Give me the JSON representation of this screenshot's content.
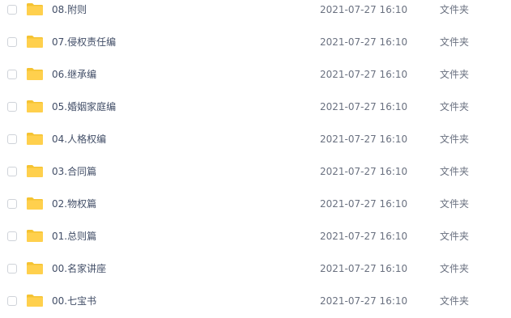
{
  "files": [
    {
      "name": "08.附则",
      "modified": "2021-07-27 16:10",
      "type": "文件夹",
      "icon": "folder-icon"
    },
    {
      "name": "07.侵权责任编",
      "modified": "2021-07-27 16:10",
      "type": "文件夹",
      "icon": "folder-icon"
    },
    {
      "name": "06.继承编",
      "modified": "2021-07-27 16:10",
      "type": "文件夹",
      "icon": "folder-icon"
    },
    {
      "name": "05.婚姻家庭编",
      "modified": "2021-07-27 16:10",
      "type": "文件夹",
      "icon": "folder-icon"
    },
    {
      "name": "04.人格权编",
      "modified": "2021-07-27 16:10",
      "type": "文件夹",
      "icon": "folder-icon"
    },
    {
      "name": "03.合同篇",
      "modified": "2021-07-27 16:10",
      "type": "文件夹",
      "icon": "folder-icon"
    },
    {
      "name": "02.物权篇",
      "modified": "2021-07-27 16:10",
      "type": "文件夹",
      "icon": "folder-icon"
    },
    {
      "name": "01.总则篇",
      "modified": "2021-07-27 16:10",
      "type": "文件夹",
      "icon": "folder-icon"
    },
    {
      "name": "00.名家讲座",
      "modified": "2021-07-27 16:10",
      "type": "文件夹",
      "icon": "folder-icon"
    },
    {
      "name": "00.七宝书",
      "modified": "2021-07-27 16:10",
      "type": "文件夹",
      "icon": "folder-icon"
    }
  ],
  "colors": {
    "folder": "#ffd04d",
    "folder_tab": "#f5c332",
    "name_text": "#424e67",
    "meta_text": "#6a7180",
    "checkbox_border": "#cfd3d9"
  }
}
